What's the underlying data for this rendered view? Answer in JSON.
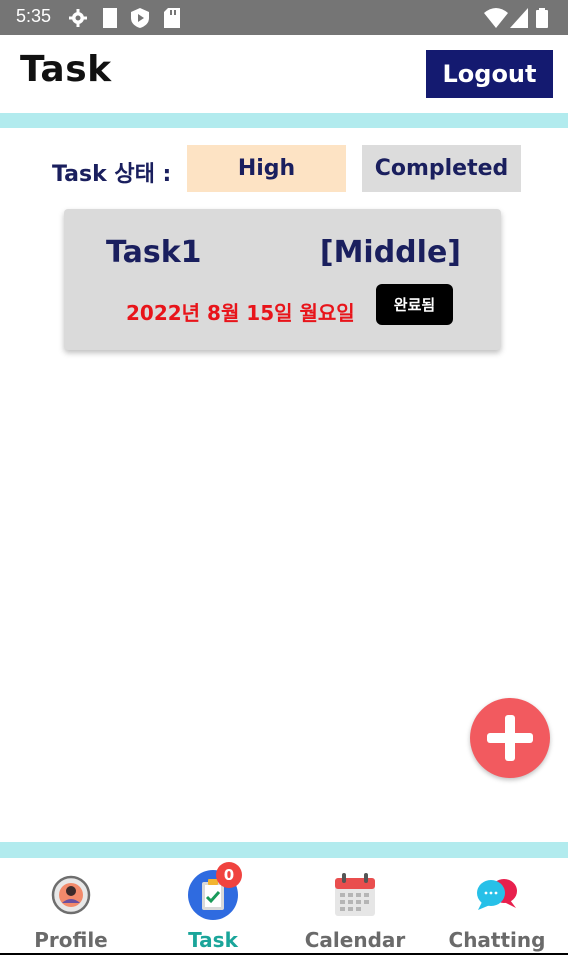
{
  "status_bar": {
    "time": "5:35"
  },
  "header": {
    "title": "Task",
    "logout_label": "Logout"
  },
  "filter": {
    "label": "Task 상태 :",
    "priority_option": "High",
    "status_option": "Completed"
  },
  "tasks": [
    {
      "name": "Task1",
      "priority": "[Middle]",
      "date": "2022년 8월 15일 월요일",
      "status": "완료됨"
    }
  ],
  "bottom_nav": {
    "items": [
      {
        "label": "Profile",
        "icon": "profile-icon"
      },
      {
        "label": "Task",
        "icon": "task-clipboard-icon",
        "badge": "0"
      },
      {
        "label": "Calendar",
        "icon": "calendar-icon"
      },
      {
        "label": "Chatting",
        "icon": "chat-bubbles-icon"
      }
    ],
    "active": "Task"
  },
  "colors": {
    "logout_bg": "#141a70",
    "divider": "#b2ebee",
    "high_bg": "#fde3c4",
    "date_text": "#e8141a",
    "fab": "#f25a5f",
    "active_nav": "#1aa59a"
  }
}
